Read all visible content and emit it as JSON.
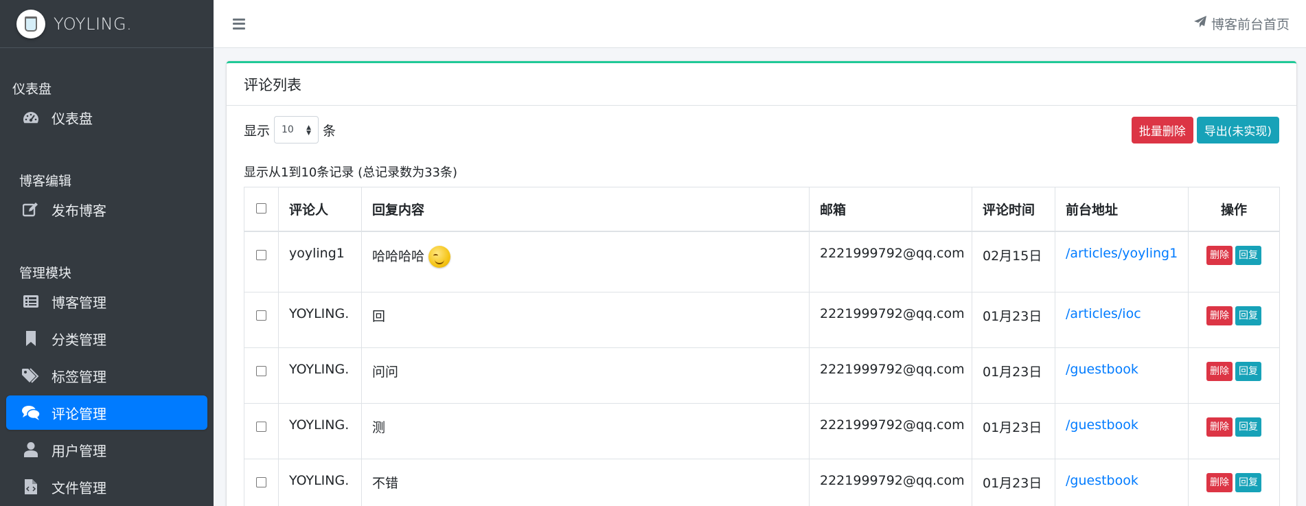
{
  "brand": {
    "name": "YOYLING."
  },
  "sidebar": {
    "groups": [
      {
        "header": "仪表盘",
        "items": [
          {
            "label": "仪表盘",
            "icon": "tachometer-icon"
          }
        ]
      },
      {
        "header": "博客编辑",
        "items": [
          {
            "label": "发布博客",
            "icon": "edit-icon"
          }
        ]
      },
      {
        "header": "管理模块",
        "items": [
          {
            "label": "博客管理",
            "icon": "list-icon"
          },
          {
            "label": "分类管理",
            "icon": "bookmark-icon"
          },
          {
            "label": "标签管理",
            "icon": "tags-icon"
          },
          {
            "label": "评论管理",
            "icon": "comments-icon",
            "active": true
          },
          {
            "label": "用户管理",
            "icon": "user-icon"
          },
          {
            "label": "文件管理",
            "icon": "file-code-icon"
          }
        ]
      }
    ]
  },
  "topbar": {
    "front_link": "博客前台首页"
  },
  "card": {
    "title": "评论列表",
    "length_prefix": "显示",
    "length_value": "10",
    "length_suffix": "条",
    "batch_delete": "批量删除",
    "export": "导出(未实现)",
    "info": "显示从1到10条记录 (总记录数为33条)"
  },
  "table": {
    "headers": [
      "评论人",
      "回复内容",
      "邮箱",
      "评论时间",
      "前台地址",
      "操作"
    ],
    "rows": [
      {
        "commenter": "yoyling1",
        "content": "哈哈哈哈",
        "emoji": true,
        "email": "2221999792@qq.com",
        "time": "02月15日",
        "url": "/articles/yoyling1"
      },
      {
        "commenter": "YOYLING.",
        "content": "回",
        "email": "2221999792@qq.com",
        "time": "01月23日",
        "url": "/articles/ioc"
      },
      {
        "commenter": "YOYLING.",
        "content": "问问",
        "email": "2221999792@qq.com",
        "time": "01月23日",
        "url": "/guestbook"
      },
      {
        "commenter": "YOYLING.",
        "content": "测",
        "email": "2221999792@qq.com",
        "time": "01月23日",
        "url": "/guestbook"
      },
      {
        "commenter": "YOYLING.",
        "content": "不错",
        "email": "2221999792@qq.com",
        "time": "01月23日",
        "url": "/guestbook"
      }
    ],
    "delete_label": "删除",
    "reply_label": "回复"
  }
}
